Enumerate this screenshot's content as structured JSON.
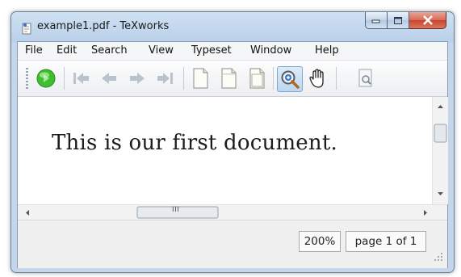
{
  "window": {
    "title": "example1.pdf - TeXworks"
  },
  "menubar": {
    "items": [
      "File",
      "Edit",
      "Search",
      "View",
      "Typeset",
      "Window",
      "Help"
    ]
  },
  "toolbar": {
    "icons": [
      "typeset-run-icon",
      "first-page-icon",
      "previous-page-icon",
      "next-page-icon",
      "last-page-icon",
      "actual-size-icon",
      "fit-width-icon",
      "fit-window-icon",
      "magnify-icon",
      "hand-scroll-icon",
      "find-icon"
    ]
  },
  "document": {
    "text": "This is our first document."
  },
  "scrollbar": {
    "h_grip": "III"
  },
  "status": {
    "zoom": "200%",
    "page": "page 1 of 1"
  },
  "colors": {
    "titlebar": "#c5d8ee",
    "close_button": "#c7452d",
    "typeset_button": "#3fbf30",
    "magnify_active": "#bcd7f0"
  }
}
